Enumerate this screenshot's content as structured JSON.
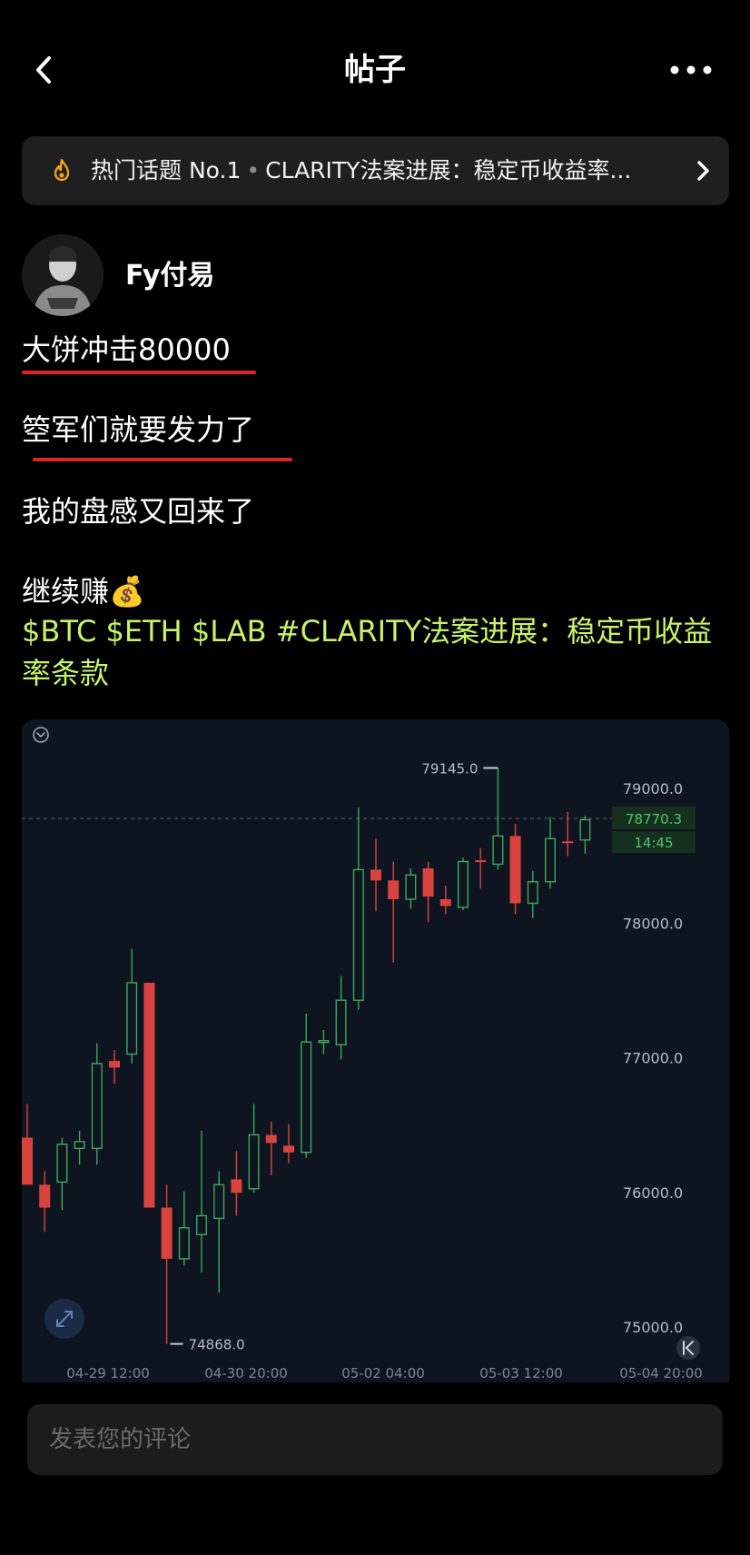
{
  "header": {
    "title": "帖子",
    "back_icon": "chevron-left-icon",
    "more_icon": "more-horizontal-icon"
  },
  "banner": {
    "icon": "fire-icon",
    "prefix": "热门话题 No.1",
    "text": "CLARITY法案进展：稳定币收益率...",
    "chevron_icon": "chevron-right-icon",
    "icon_color": "#f0a020"
  },
  "author": {
    "name": "Fy付易"
  },
  "post": {
    "line1": "大饼冲击80000",
    "line2": "箜军们就要发力了",
    "line3": "我的盘感又回来了",
    "line4": "继续赚",
    "emoji": "💰",
    "tags": "$BTC $ETH $LAB #CLARITY法案进展：稳定币收益率条款",
    "tag_color": "#c7f36a",
    "underline_color": "#e02424"
  },
  "chart_data": {
    "type": "candlestick",
    "y_ticks": [
      "79000.0",
      "78000.0",
      "77000.0",
      "76000.0",
      "75000.0"
    ],
    "y_tick_values": [
      79000,
      78000,
      77000,
      76000,
      75000
    ],
    "x_ticks": [
      "04-29 12:00",
      "04-30 20:00",
      "05-02 04:00",
      "05-03 12:00",
      "05-04 20:00"
    ],
    "high_label": "79145.0",
    "low_label": "74868.0",
    "current_price": "78770.3",
    "countdown": "14:45",
    "up_color": "#3ea85a",
    "down_color": "#d9433f",
    "candles": [
      {
        "o": 76400,
        "c": 76050,
        "h": 76650,
        "l": 76300
      },
      {
        "o": 76050,
        "c": 75880,
        "h": 76150,
        "l": 75700
      },
      {
        "o": 76070,
        "c": 76350,
        "h": 76400,
        "l": 75860
      },
      {
        "o": 76320,
        "c": 76370,
        "h": 76450,
        "l": 76200
      },
      {
        "o": 76320,
        "c": 76950,
        "h": 77100,
        "l": 76200
      },
      {
        "o": 76970,
        "c": 76920,
        "h": 77050,
        "l": 76800
      },
      {
        "o": 77020,
        "c": 77550,
        "h": 77800,
        "l": 76950
      },
      {
        "o": 77550,
        "c": 75880,
        "h": 77550,
        "l": 75880
      },
      {
        "o": 75880,
        "c": 75500,
        "h": 76050,
        "l": 74868
      },
      {
        "o": 75500,
        "c": 75730,
        "h": 76000,
        "l": 75450
      },
      {
        "o": 75680,
        "c": 75820,
        "h": 76450,
        "l": 75400
      },
      {
        "o": 75800,
        "c": 76050,
        "h": 76150,
        "l": 75250
      },
      {
        "o": 76090,
        "c": 75990,
        "h": 76300,
        "l": 75820
      },
      {
        "o": 76020,
        "c": 76420,
        "h": 76650,
        "l": 75990
      },
      {
        "o": 76420,
        "c": 76360,
        "h": 76520,
        "l": 76120
      },
      {
        "o": 76340,
        "c": 76290,
        "h": 76500,
        "l": 76210
      },
      {
        "o": 76290,
        "c": 77110,
        "h": 77320,
        "l": 76250
      },
      {
        "o": 77110,
        "c": 77120,
        "h": 77200,
        "l": 77020
      },
      {
        "o": 77090,
        "c": 77420,
        "h": 77600,
        "l": 76980
      },
      {
        "o": 77420,
        "c": 78390,
        "h": 78850,
        "l": 77350
      },
      {
        "o": 78390,
        "c": 78310,
        "h": 78620,
        "l": 78080
      },
      {
        "o": 78310,
        "c": 78170,
        "h": 78450,
        "l": 77700
      },
      {
        "o": 78170,
        "c": 78350,
        "h": 78400,
        "l": 78100
      },
      {
        "o": 78400,
        "c": 78190,
        "h": 78450,
        "l": 78000
      },
      {
        "o": 78170,
        "c": 78120,
        "h": 78270,
        "l": 78060
      },
      {
        "o": 78110,
        "c": 78450,
        "h": 78480,
        "l": 78090
      },
      {
        "o": 78460,
        "c": 78450,
        "h": 78550,
        "l": 78250
      },
      {
        "o": 78430,
        "c": 78640,
        "h": 79145,
        "l": 78390
      },
      {
        "o": 78640,
        "c": 78140,
        "h": 78730,
        "l": 78060
      },
      {
        "o": 78140,
        "c": 78300,
        "h": 78380,
        "l": 78030
      },
      {
        "o": 78300,
        "c": 78620,
        "h": 78780,
        "l": 78250
      },
      {
        "o": 78600,
        "c": 78590,
        "h": 78820,
        "l": 78490
      },
      {
        "o": 78610,
        "c": 78760,
        "h": 78790,
        "l": 78510
      }
    ]
  },
  "comment": {
    "placeholder": "发表您的评论"
  }
}
